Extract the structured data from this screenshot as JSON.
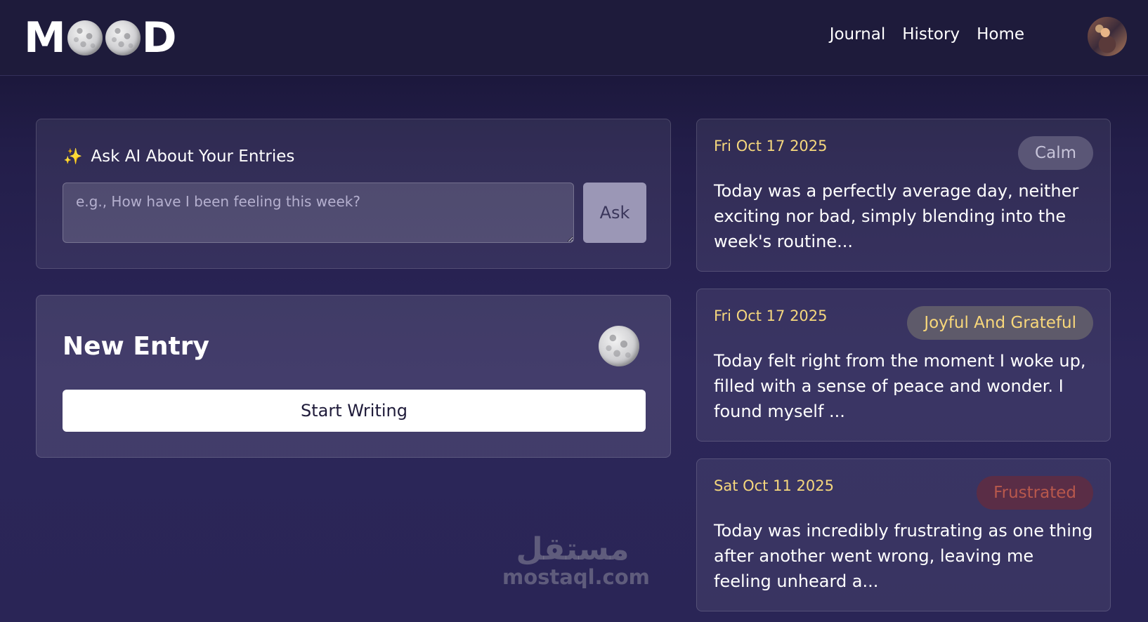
{
  "header": {
    "logo_left": "M",
    "logo_right": "D",
    "nav": [
      "Journal",
      "History",
      "Home"
    ]
  },
  "ask": {
    "title": "Ask AI About Your Entries",
    "placeholder": "e.g., How have I been feeling this week?",
    "button_label": "Ask"
  },
  "new_entry": {
    "title": "New Entry",
    "button_label": "Start Writing"
  },
  "history": [
    {
      "date": "Fri Oct 17 2025",
      "mood": "Calm",
      "text": "Today was a perfectly average day, neither exciting nor bad, simply blending into the week's routine..."
    },
    {
      "date": "Fri Oct 17 2025",
      "mood": "Joyful And Grateful",
      "text": "Today felt right from the moment I woke up, filled with a sense of peace and wonder. I found myself ..."
    },
    {
      "date": "Sat Oct 11 2025",
      "mood": "Frustrated",
      "text": "Today was incredibly frustrating as one thing after another went wrong, leaving me feeling unheard a..."
    }
  ],
  "watermark": {
    "arabic": "مستقل",
    "latin": "mostaql.com"
  },
  "colors": {
    "date_accent": "#f5d77d",
    "calm_badge": "#5a5676",
    "joy_badge_text": "#f8d77a",
    "frustrated_badge_text": "#b8584c"
  }
}
